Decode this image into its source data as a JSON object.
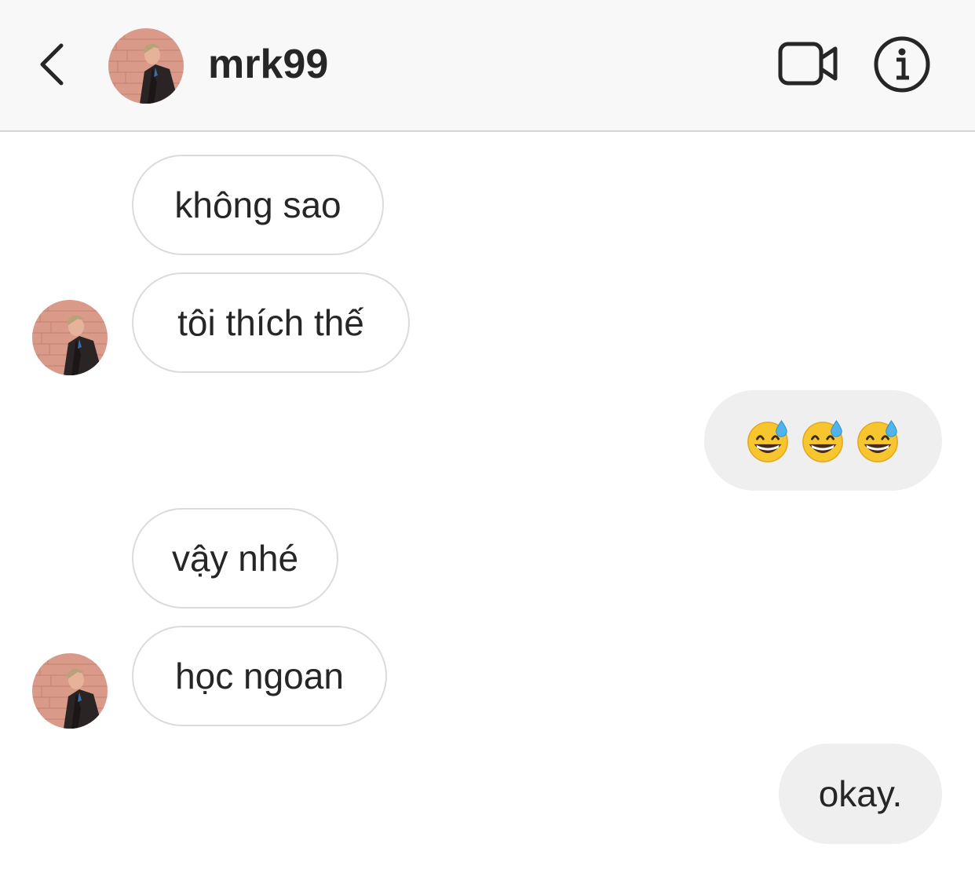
{
  "header": {
    "username": "mrk99",
    "back_icon": "chevron-left-icon",
    "video_icon": "video-camera-icon",
    "info_icon": "info-icon"
  },
  "colors": {
    "header_bg": "#f8f8f8",
    "incoming_border": "#dbdbdb",
    "outgoing_bg": "#efefef",
    "text": "#262626"
  },
  "messages": [
    {
      "direction": "incoming",
      "text": "không sao",
      "show_avatar": false
    },
    {
      "direction": "incoming",
      "text": "tôi thích thế",
      "show_avatar": true
    },
    {
      "direction": "outgoing",
      "emoji": [
        "grinning-face-with-sweat",
        "grinning-face-with-sweat",
        "grinning-face-with-sweat"
      ]
    },
    {
      "direction": "incoming",
      "text": "vậy nhé",
      "show_avatar": false
    },
    {
      "direction": "incoming",
      "text": "học ngoan",
      "show_avatar": true
    },
    {
      "direction": "outgoing",
      "text": "okay."
    }
  ]
}
